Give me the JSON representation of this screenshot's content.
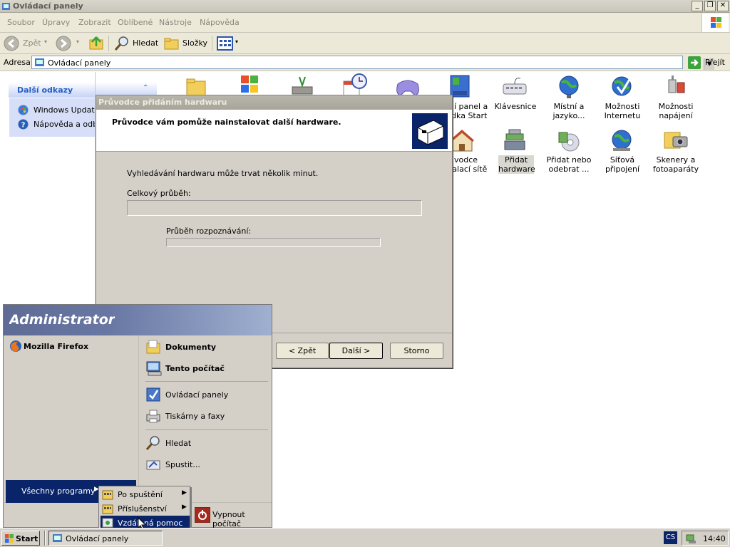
{
  "window": {
    "title": "Ovládací panely"
  },
  "menu": [
    "Soubor",
    "Úpravy",
    "Zobrazit",
    "Oblíbené",
    "Nástroje",
    "Nápověda"
  ],
  "toolbar": {
    "back": "Zpět",
    "search": "Hledat",
    "folders": "Složky"
  },
  "address": {
    "label": "Adresa",
    "value": "Ovládací panely",
    "go": "Přejít"
  },
  "left_pane": {
    "header": "Další odkazy",
    "links": [
      "Windows Update",
      "Nápověda a odbo"
    ]
  },
  "icons_row1": [
    {
      "label": "ní panel a\nídka Start"
    },
    {
      "label": "Klávesnice"
    },
    {
      "label": "Místní a\njazyko..."
    },
    {
      "label": "Možnosti\nInternetu"
    },
    {
      "label": "Možnosti\nnapájení"
    }
  ],
  "icons_row2": [
    {
      "label": "ůvodce\ntalací sítě"
    },
    {
      "label": "Přidat\nhardware"
    },
    {
      "label": "Přidat nebo\nodebrat ..."
    },
    {
      "label": "Síťová\npřipojení"
    },
    {
      "label": "Skenery a\nfotoaparáty"
    }
  ],
  "wizard": {
    "title": "Průvodce přidáním hardwaru",
    "header": "Průvodce vám pomůže nainstalovat další hardware.",
    "info": "Vyhledávání hardwaru může trvat několik minut.",
    "overall_label": "Celkový průběh:",
    "overall_progress": 0,
    "detect_label": "Průběh rozpoznávání:",
    "detect_progress": 0,
    "back": "< Zpět",
    "next": "Další >",
    "cancel": "Storno"
  },
  "start_menu": {
    "user": "Administrator",
    "pinned": [
      "Mozilla Firefox"
    ],
    "right": {
      "bold": [
        "Dokumenty",
        "Tento počítač"
      ],
      "group2": [
        "Ovládací panely",
        "Tiskárny a faxy"
      ],
      "group3": [
        "Hledat",
        "Spustit..."
      ]
    },
    "all_programs": "Všechny programy",
    "shutdown": "Vypnout počítač"
  },
  "submenu": [
    "Po spuštění",
    "Příslušenství",
    "Vzdálená pomoc"
  ],
  "taskbar": {
    "start": "Start",
    "task": "Ovládací panely",
    "lang": "CS",
    "clock": "14:40"
  },
  "colors": {
    "selection": "#0a246a",
    "link": "#215dc6"
  }
}
